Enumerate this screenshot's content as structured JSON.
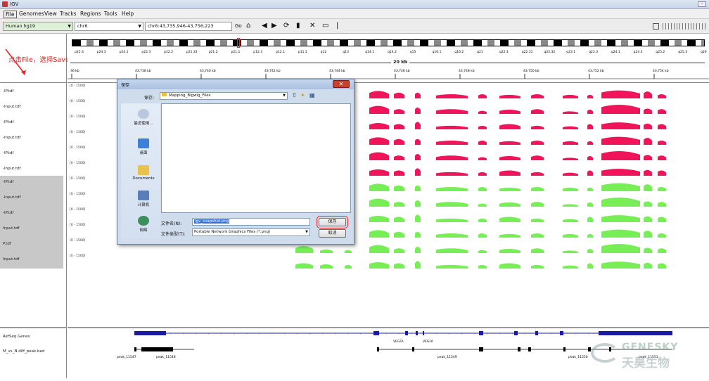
{
  "window": {
    "title": "IGV"
  },
  "menu": [
    "File",
    "Genomes",
    "View",
    "Tracks",
    "Regions",
    "Tools",
    "Help"
  ],
  "toolbar": {
    "genome": "Human hg19",
    "chrom": "chr6",
    "locus": "chr6:43,735,946-43,756,223",
    "go": "Go"
  },
  "ideogram_bands": [
    "p25.3",
    "p24.3",
    "p24.1",
    "p22.3",
    "p22.2",
    "p21.33",
    "p21.2",
    "p21.1",
    "p12.3",
    "p12.1",
    "p11.1",
    "q12",
    "q13",
    "q14.1",
    "q14.2",
    "q15",
    "q16.1",
    "q16.2",
    "q21",
    "q22.1",
    "q22.31",
    "q22.32",
    "q23.1",
    "q23.3",
    "q24.1",
    "q24.3",
    "q25.2",
    "q25.3",
    "q26"
  ],
  "span_label": "20 kb",
  "ruler_ticks": [
    "36 kb",
    "43,738 kb",
    "43,740 kb",
    "43,742 kb",
    "43,744 kb",
    "43,746 kb",
    "43,748 kb",
    "43,750 kb",
    "43,752 kb",
    "43,754 kb"
  ],
  "annotation": "点击File，选择Save Image",
  "tracks": [
    {
      "name": "-IP.tdf",
      "scale": "[0 - 1500]",
      "color": "#f0145a"
    },
    {
      "name": "-Input.tdf",
      "scale": "[0 - 1500]",
      "color": "#f0145a"
    },
    {
      "name": "-IP.tdf",
      "scale": "[0 - 1500]",
      "color": "#f0145a"
    },
    {
      "name": "-Input.tdf",
      "scale": "[0 - 1500]",
      "color": "#f0145a"
    },
    {
      "name": "-IP.tdf",
      "scale": "[0 - 1500]",
      "color": "#f0145a"
    },
    {
      "name": "-Input.tdf",
      "scale": "[0 - 1500]",
      "color": "#f0145a"
    },
    {
      "name": "-IP.tdf",
      "scale": "[0 - 1500]",
      "color": "#77ee55"
    },
    {
      "name": "-Input.tdf",
      "scale": "[0 - 1500]",
      "color": "#77ee55"
    },
    {
      "name": "-IP.tdf",
      "scale": "[0 - 1500]",
      "color": "#77ee55"
    },
    {
      "name": "Input.tdf",
      "scale": "[0 - 1500]",
      "color": "#77ee55"
    },
    {
      "name": "P.tdf",
      "scale": "[0 - 1500]",
      "color": "#77ee55"
    },
    {
      "name": "Input.tdf",
      "scale": "[0 - 1500]",
      "color": "#77ee55"
    }
  ],
  "bottom_tracks": [
    {
      "name": "RefSeq Genes"
    },
    {
      "name": "M_vs_N.diff_peak.bed"
    }
  ],
  "gene_labels": [
    "VEGFA",
    "VEGFA"
  ],
  "peak_labels": [
    "peak_11547",
    "peak_11548",
    "peak_11549",
    "peak_11550",
    "peak_11551"
  ],
  "dialog": {
    "title": "保存",
    "save_in_label": "保存:",
    "folder": "Mapping_Bigwig_Files",
    "places": [
      "最近使用...",
      "桌面",
      "Documents",
      "计算机",
      "网络"
    ],
    "filename_label": "文件名(N):",
    "filename": "igv_snapshot.png",
    "filetype_label": "文件类型(T):",
    "filetype": "Portable Network Graphics Files (*.png)",
    "save_button": "保存",
    "cancel_button": "取消",
    "close": "✕"
  },
  "watermark": {
    "en": "GENESKY",
    "cn": "天昊生物"
  },
  "colors": {
    "ip": "#f0145a",
    "input_green": "#77ee55",
    "highlight": "#e22222",
    "gene": "#1a1aa6"
  }
}
